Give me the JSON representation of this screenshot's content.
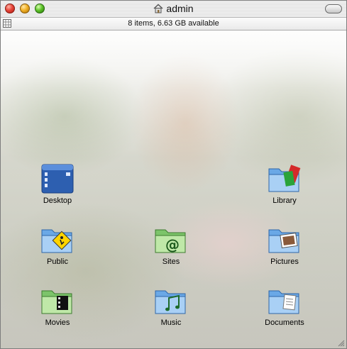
{
  "window": {
    "title": "admin",
    "status": "8 items, 6.63 GB available"
  },
  "items": [
    {
      "label": "Desktop",
      "icon": "desktop-folder-icon"
    },
    {
      "label": "Library",
      "icon": "library-folder-icon"
    },
    {
      "label": "Public",
      "icon": "public-folder-icon"
    },
    {
      "label": "Sites",
      "icon": "sites-folder-icon"
    },
    {
      "label": "Pictures",
      "icon": "pictures-folder-icon"
    },
    {
      "label": "Movies",
      "icon": "movies-folder-icon"
    },
    {
      "label": "Music",
      "icon": "music-folder-icon"
    },
    {
      "label": "Documents",
      "icon": "documents-folder-icon"
    }
  ],
  "colors": {
    "folder_blue": "#4f8fd4",
    "folder_light": "#a9d0f5",
    "close_red": "#e8463a",
    "minimize_amber": "#f1b127",
    "zoom_green": "#5fc42a"
  }
}
